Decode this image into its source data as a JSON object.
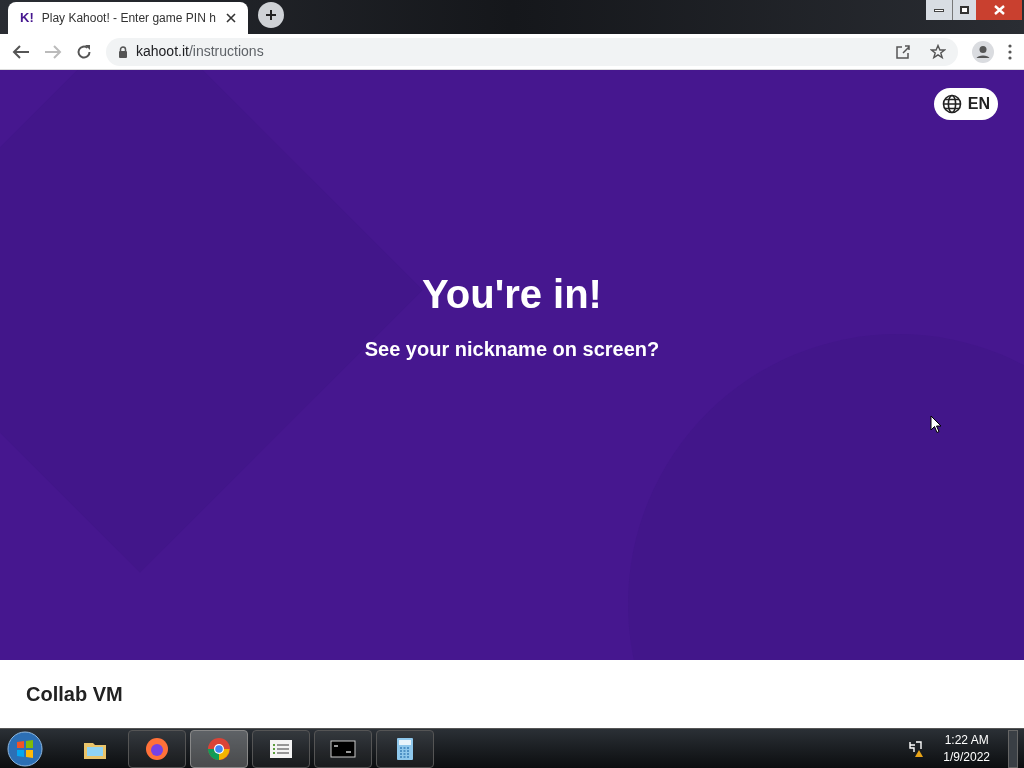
{
  "browser": {
    "tab": {
      "favicon": "K!",
      "title": "Play Kahoot! - Enter game PIN h",
      "selected": true
    },
    "url": {
      "host": "kahoot.it",
      "path": "/instructions"
    }
  },
  "page": {
    "language": "EN",
    "heading": "You're in!",
    "subheading": "See your nickname on screen?"
  },
  "footer": {
    "title": "Collab VM"
  },
  "taskbar": {
    "apps": [
      {
        "kind": "explorer",
        "selected": false
      },
      {
        "kind": "firefox",
        "selected": false
      },
      {
        "kind": "chrome",
        "selected": true
      },
      {
        "kind": "list",
        "selected": false
      },
      {
        "kind": "cmd",
        "selected": false
      },
      {
        "kind": "calculator",
        "selected": false
      }
    ],
    "clock": {
      "time": "1:22 AM",
      "date": "1/9/2022"
    }
  }
}
